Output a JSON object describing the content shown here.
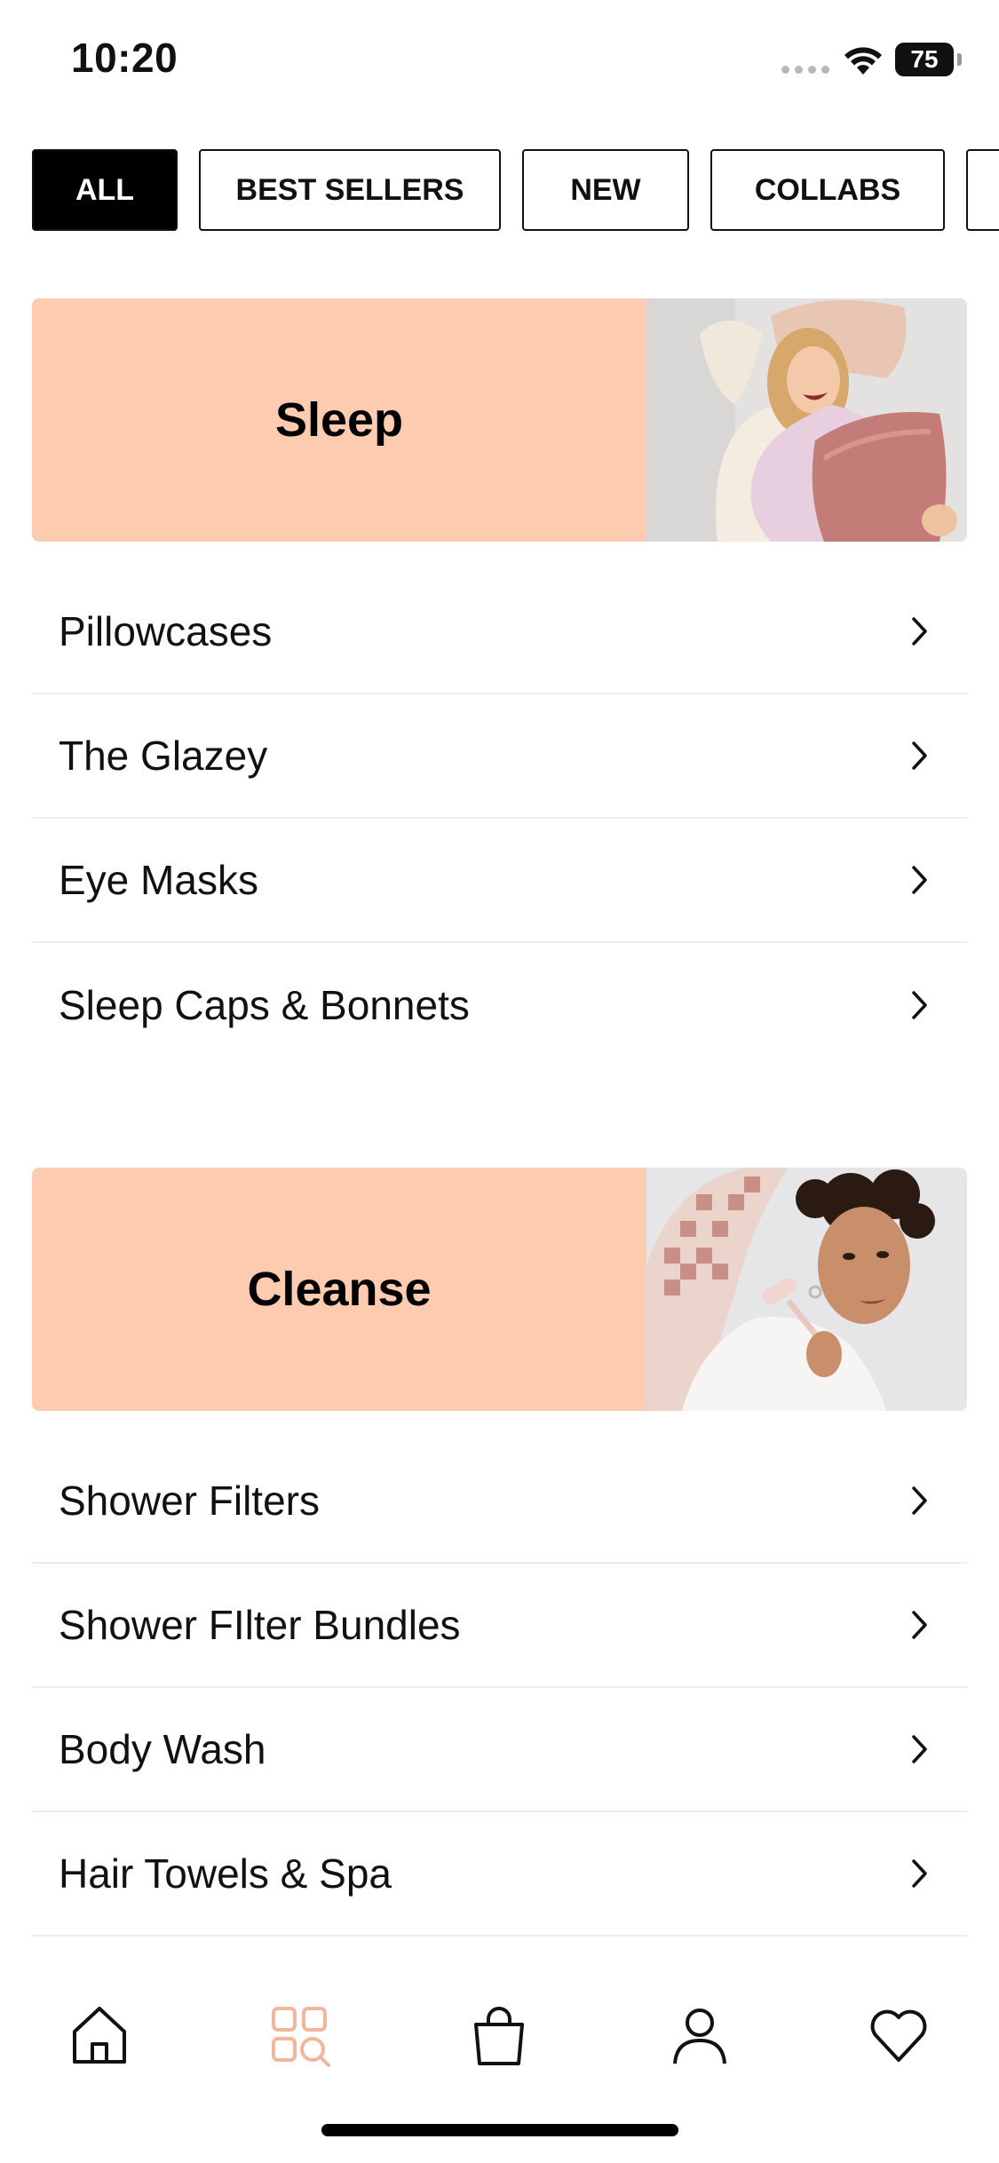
{
  "status_bar": {
    "time": "10:20",
    "battery": "75"
  },
  "tabs": [
    {
      "label": "ALL",
      "active": true
    },
    {
      "label": "BEST SELLERS",
      "active": false
    },
    {
      "label": "NEW",
      "active": false
    },
    {
      "label": "COLLABS",
      "active": false
    }
  ],
  "sections": [
    {
      "title": "Sleep",
      "image": "woman-with-silk-pillows-photo",
      "items": [
        {
          "label": "Pillowcases"
        },
        {
          "label": "The Glazey"
        },
        {
          "label": "Eye Masks"
        },
        {
          "label": "Sleep Caps & Bonnets"
        }
      ]
    },
    {
      "title": "Cleanse",
      "image": "woman-with-face-roller-photo",
      "items": [
        {
          "label": "Shower Filters"
        },
        {
          "label": "Shower FIlter Bundles"
        },
        {
          "label": "Body Wash"
        },
        {
          "label": "Hair Towels & Spa"
        }
      ]
    }
  ],
  "bottom_nav": [
    {
      "icon": "home-icon",
      "active": false
    },
    {
      "icon": "shop-categories-icon",
      "active": true
    },
    {
      "icon": "bag-icon",
      "active": false
    },
    {
      "icon": "account-icon",
      "active": false
    },
    {
      "icon": "wishlist-heart-icon",
      "active": false
    }
  ],
  "colors": {
    "banner_bg": "#fdcbb0",
    "accent": "#f2b79a",
    "active_tab_bg": "#000000"
  }
}
